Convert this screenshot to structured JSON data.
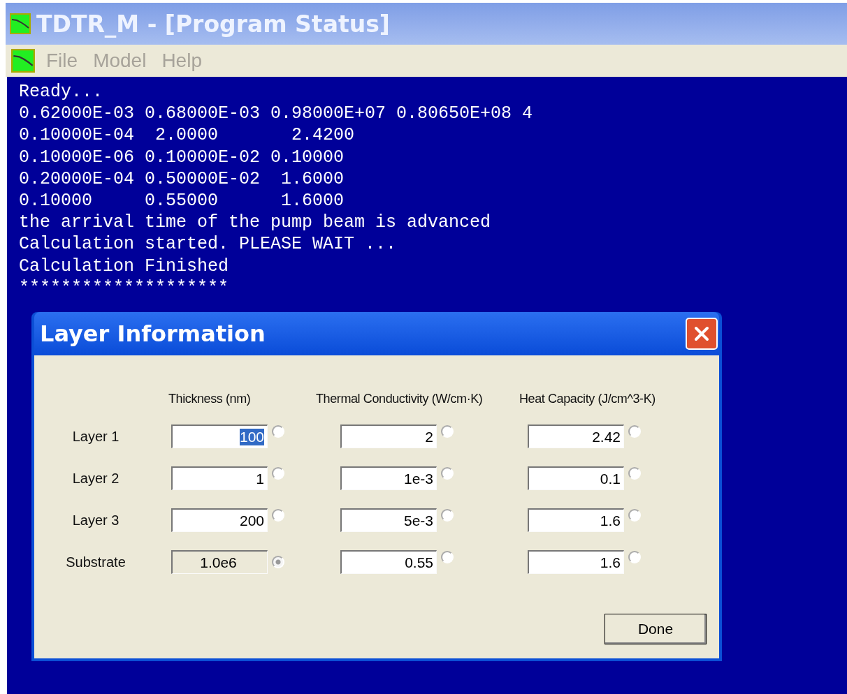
{
  "window": {
    "title": "TDTR_M - [Program Status]"
  },
  "menu": [
    {
      "label": "File",
      "disabled": true
    },
    {
      "label": "Model",
      "disabled": true
    },
    {
      "label": "Help",
      "disabled": true
    }
  ],
  "console_lines": [
    "Ready...",
    "0.62000E-03 0.68000E-03 0.98000E+07 0.80650E+08 4",
    "0.10000E-04  2.0000       2.4200",
    "0.10000E-06 0.10000E-02 0.10000",
    "0.20000E-04 0.50000E-02  1.6000",
    "0.10000     0.55000      1.6000",
    "the arrival time of the pump beam is advanced",
    "Calculation started. PLEASE WAIT ...",
    "Calculation Finished",
    "********************"
  ],
  "dialog": {
    "title": "Layer Information",
    "columns": [
      "Thickness (nm)",
      "Thermal Conductivity (W/cm·K)",
      "Heat Capacity (J/cm^3-K)"
    ],
    "rows": [
      {
        "label": "Layer 1",
        "cells": [
          {
            "value": "100",
            "highlighted": true,
            "disabled": false,
            "selected": false
          },
          {
            "value": "2",
            "highlighted": false,
            "disabled": false,
            "selected": false
          },
          {
            "value": "2.42",
            "highlighted": false,
            "disabled": false,
            "selected": false
          }
        ]
      },
      {
        "label": "Layer 2",
        "cells": [
          {
            "value": "1",
            "highlighted": false,
            "disabled": false,
            "selected": false
          },
          {
            "value": "1e-3",
            "highlighted": false,
            "disabled": false,
            "selected": false
          },
          {
            "value": "0.1",
            "highlighted": false,
            "disabled": false,
            "selected": false
          }
        ]
      },
      {
        "label": "Layer 3",
        "cells": [
          {
            "value": "200",
            "highlighted": false,
            "disabled": false,
            "selected": false
          },
          {
            "value": "5e-3",
            "highlighted": false,
            "disabled": false,
            "selected": false
          },
          {
            "value": "1.6",
            "highlighted": false,
            "disabled": false,
            "selected": false
          }
        ]
      },
      {
        "label": "Substrate",
        "cells": [
          {
            "value": "1.0e6",
            "highlighted": false,
            "disabled": true,
            "selected": true
          },
          {
            "value": "0.55",
            "highlighted": false,
            "disabled": false,
            "selected": false
          },
          {
            "value": "1.6",
            "highlighted": false,
            "disabled": false,
            "selected": false
          }
        ]
      }
    ],
    "done_button": "Done"
  }
}
